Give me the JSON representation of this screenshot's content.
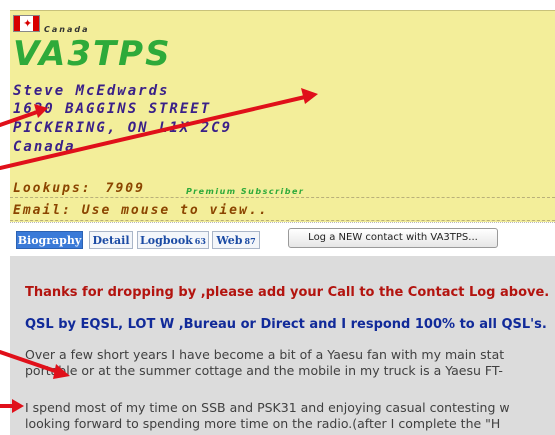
{
  "profile": {
    "country_small": "Canada",
    "callsign": "VA3TPS",
    "name": "Steve McEdwards",
    "street": "1630 BAGGINS STREET",
    "city": "PICKERING, ON L1X 2C9",
    "country": "Canada",
    "lookups_label": "Lookups:",
    "lookups_count": "7909",
    "premium": "Premium Subscriber",
    "email": "Email: Use mouse to view.."
  },
  "tabs": [
    {
      "label": "Biography",
      "count": ""
    },
    {
      "label": "Detail",
      "count": ""
    },
    {
      "label": "Logbook",
      "count": "63"
    },
    {
      "label": "Web",
      "count": "87"
    }
  ],
  "log_button": "Log a NEW contact with VA3TPS...",
  "bio": {
    "line1": "Thanks for dropping by ,please add your Call to the Contact Log above.",
    "line2": "QSL by EQSL, LOT W ,Bureau or Direct and I respond 100% to all QSL's.",
    "line3": "Over a few short years I have become a bit of  a Yaesu fan with my main stat",
    "line4": "portable or at the summer cottage and the mobile in my truck is a Yaesu FT-",
    "line5": "I spend most of my time on SSB and PSK31 and enjoying casual contesting w",
    "line6": "looking forward to spending more time on the radio.(after I complete the \"H"
  },
  "icons": {
    "flag": "canada-flag-icon",
    "arrow": "red-arrow-annotation"
  },
  "colors": {
    "header_bg": "#f3ee9a",
    "callsign": "#2eaa3a",
    "address": "#3a2089",
    "annotation": "#e0101a"
  }
}
